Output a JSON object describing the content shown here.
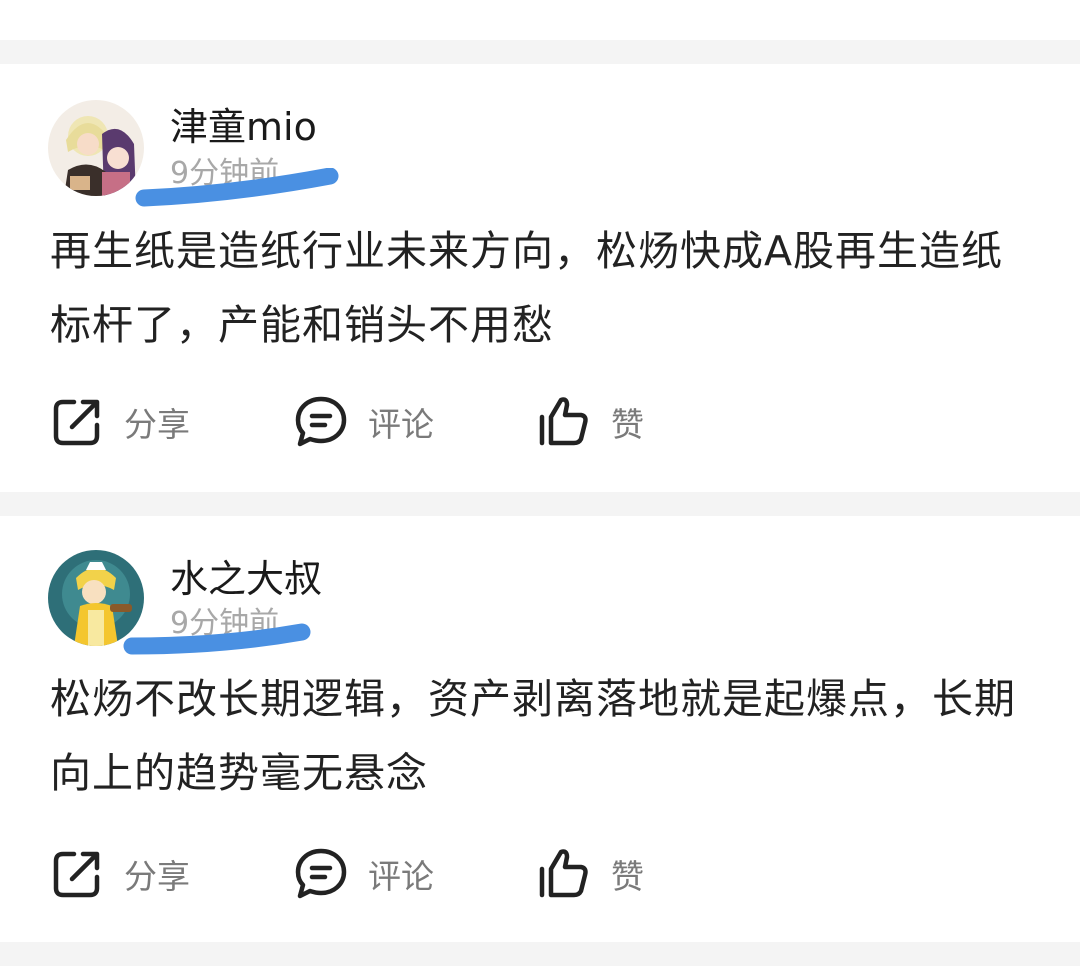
{
  "posts": [
    {
      "username": "津童mio",
      "time": "9分钟前",
      "content": "再生纸是造纸行业未来方向，松炀快成A股再生造纸标杆了，产能和销头不用愁",
      "actions": {
        "share": "分享",
        "comment": "评论",
        "like": "赞"
      }
    },
    {
      "username": "水之大叔",
      "time": "9分钟前",
      "content": "松炀不改长期逻辑，资产剥离落地就是起爆点，长期向上的趋势毫无悬念",
      "actions": {
        "share": "分享",
        "comment": "评论",
        "like": "赞"
      }
    }
  ],
  "colors": {
    "highlight": "#4a90e2",
    "separator": "#f4f4f4",
    "text": "#222222",
    "muted": "#a8a8a8"
  },
  "icons": [
    "share-icon",
    "comment-icon",
    "like-icon"
  ]
}
